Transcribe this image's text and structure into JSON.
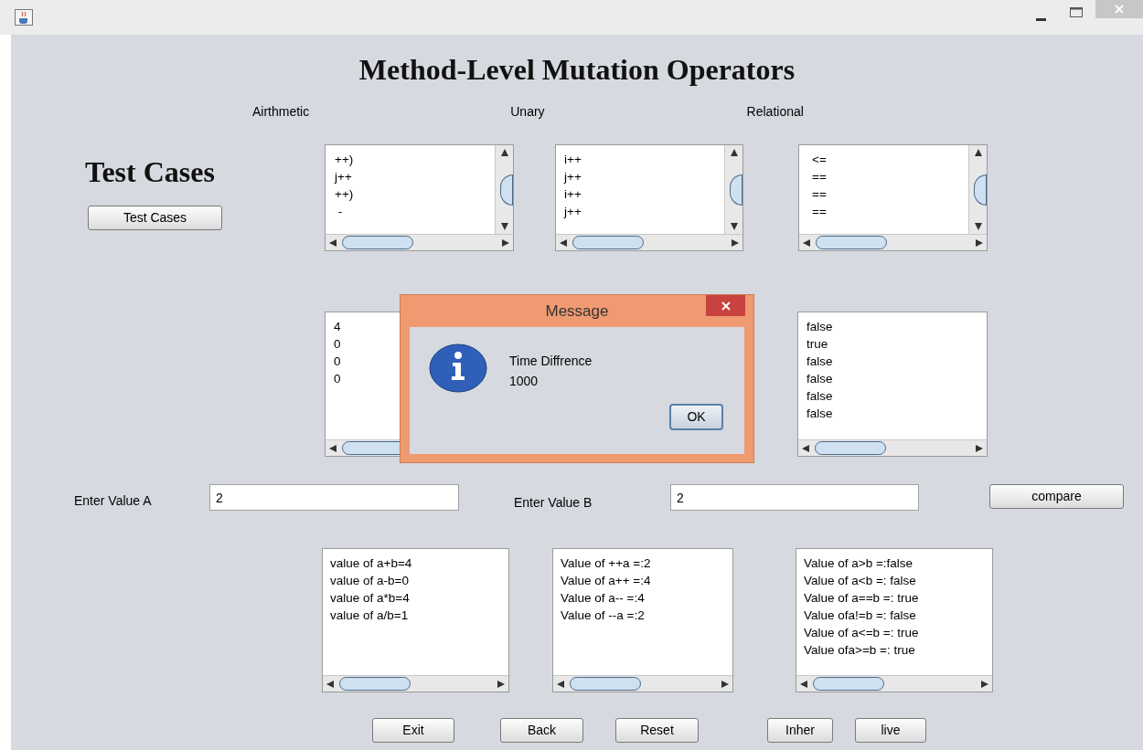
{
  "window": {
    "title": "Method-Level Mutation Operators"
  },
  "side_heading": "Test Cases",
  "test_cases_button": "Test Cases",
  "operator_lists": [
    {
      "label": "Airthmetic",
      "items": [
        "++)",
        "j++",
        "++)",
        " -"
      ]
    },
    {
      "label": "Unary",
      "items": [
        "i++",
        "j++",
        "i++",
        "j++"
      ]
    },
    {
      "label": "Relational",
      "items": [
        "<=",
        "==",
        "==",
        "=="
      ]
    }
  ],
  "result_lists": [
    {
      "items": [
        "4",
        "0",
        "0",
        "0"
      ]
    },
    {
      "items": [
        "false",
        "true",
        "false",
        "false",
        "false",
        "false"
      ]
    }
  ],
  "input_a": {
    "label": "Enter Value A",
    "value": "2"
  },
  "input_b": {
    "label": "Enter Value B",
    "value": "2"
  },
  "compare_button": "compare",
  "output_lists": [
    {
      "items": [
        "value of a+b=4",
        "value of a-b=0",
        "value of a*b=4",
        "value of a/b=1"
      ]
    },
    {
      "items": [
        "Value of ++a =:2",
        "Value of a++ =:4",
        "Value of a-- =:4",
        "Value of --a =:2"
      ]
    },
    {
      "items": [
        "Value of a>b =:false",
        "Value of a<b =: false",
        "Value of a==b =: true",
        "Value ofa!=b =: false",
        "Value of a<=b =: true",
        "Value ofa>=b =: true"
      ]
    }
  ],
  "buttons": [
    "Exit",
    "Back",
    "Reset",
    "Inher",
    "live"
  ],
  "dialog": {
    "title": "Message",
    "lines": [
      "Time Diffrence",
      "1000"
    ],
    "button": "OK"
  }
}
